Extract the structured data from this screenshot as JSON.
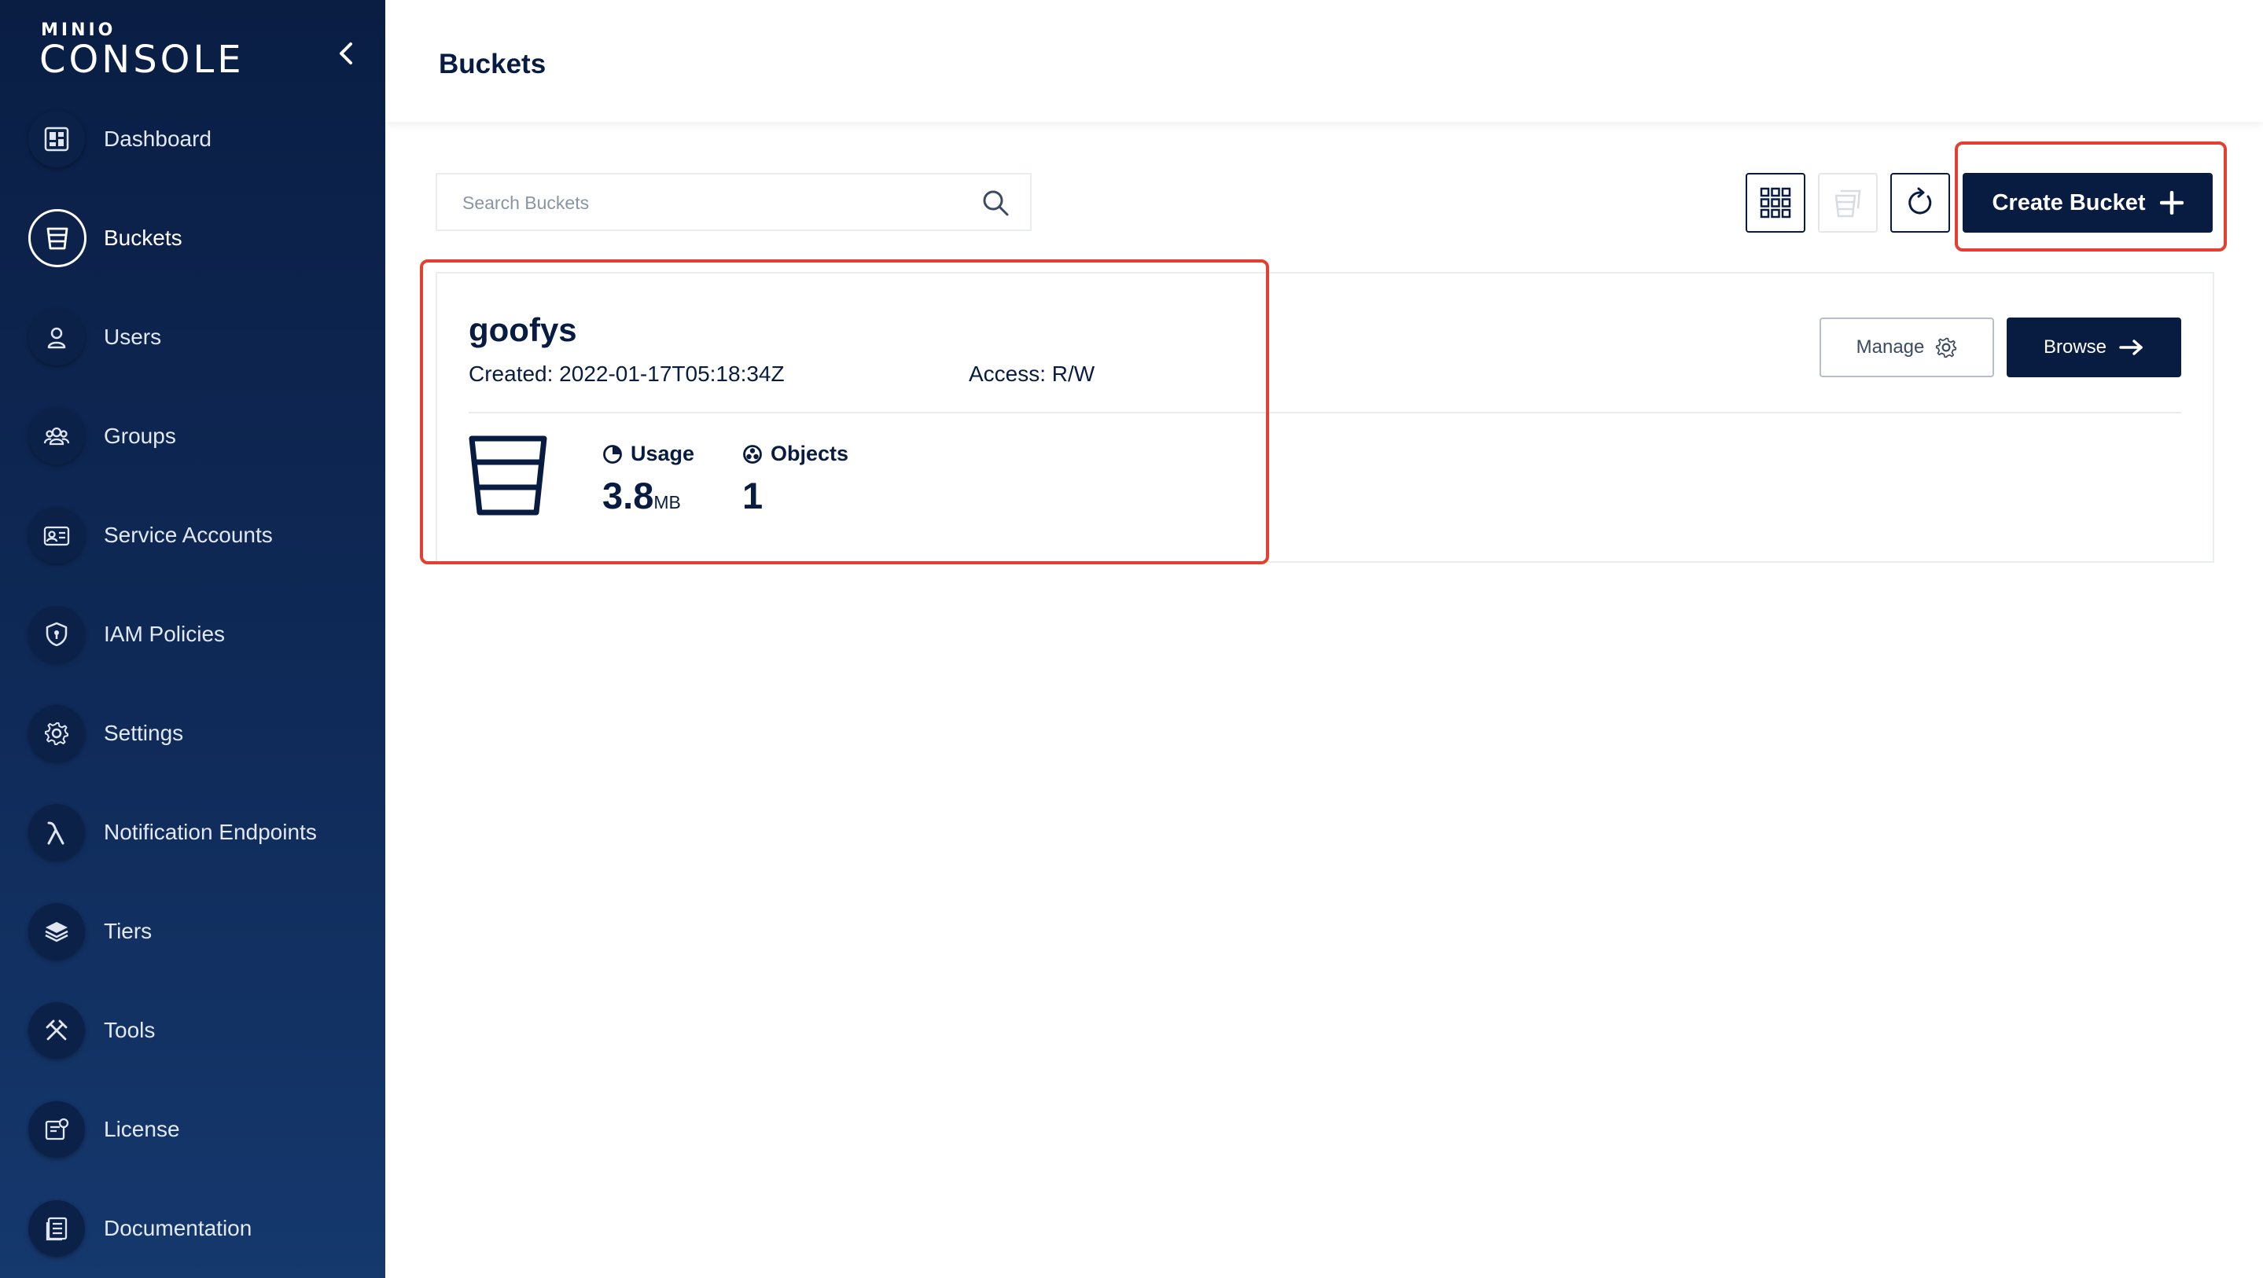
{
  "app": {
    "brand": "MINIO",
    "product": "CONSOLE"
  },
  "sidebar": {
    "items": [
      {
        "label": "Dashboard",
        "icon": "dashboard-icon"
      },
      {
        "label": "Buckets",
        "icon": "bucket-icon",
        "active": true
      },
      {
        "label": "Users",
        "icon": "user-icon"
      },
      {
        "label": "Groups",
        "icon": "groups-icon"
      },
      {
        "label": "Service Accounts",
        "icon": "service-accounts-icon"
      },
      {
        "label": "IAM Policies",
        "icon": "shield-icon"
      },
      {
        "label": "Settings",
        "icon": "gear-icon"
      },
      {
        "label": "Notification Endpoints",
        "icon": "lambda-icon"
      },
      {
        "label": "Tiers",
        "icon": "layers-icon"
      },
      {
        "label": "Tools",
        "icon": "tools-icon"
      },
      {
        "label": "License",
        "icon": "license-icon"
      },
      {
        "label": "Documentation",
        "icon": "document-icon"
      }
    ]
  },
  "header": {
    "title": "Buckets"
  },
  "toolbar": {
    "search_placeholder": "Search Buckets",
    "search_value": "",
    "create_label": "Create Bucket"
  },
  "bucket": {
    "name": "goofys",
    "created": "Created: 2022-01-17T05:18:34Z",
    "access": "Access: R/W",
    "manage_label": "Manage",
    "browse_label": "Browse",
    "usage_label": "Usage",
    "usage_value": "3.8",
    "usage_unit": "MB",
    "objects_label": "Objects",
    "objects_value": "1"
  },
  "colors": {
    "sidebar": "#0f2a58",
    "primary": "#081c42",
    "highlight": "#e4402f"
  }
}
